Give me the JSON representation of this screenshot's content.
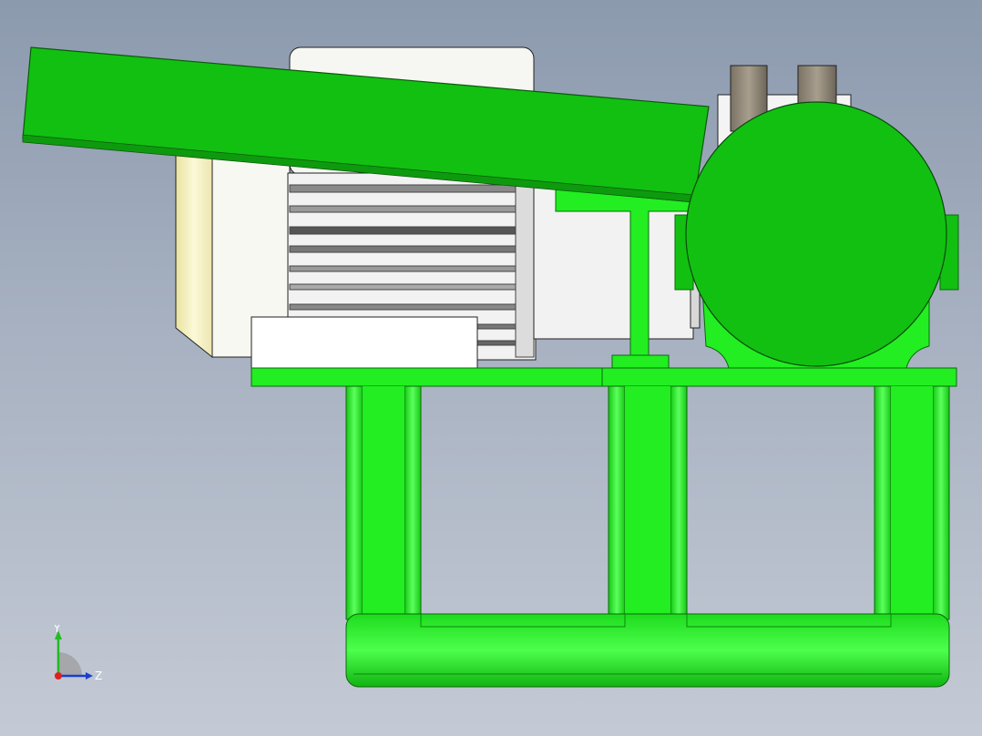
{
  "viewport": {
    "background_top": "#8c9aae",
    "background_bottom": "#c4cad5"
  },
  "model": {
    "frame_color": "#22ee22",
    "chute_color": "#12c012",
    "motor_body_color": "#f4f4f4",
    "motor_endcap_color": "#f4f0c0"
  },
  "triad": {
    "y_label": "Y",
    "z_label": "Z",
    "y_color": "#22bb22",
    "z_color": "#1a3fd0",
    "x_color": "#e02020"
  }
}
